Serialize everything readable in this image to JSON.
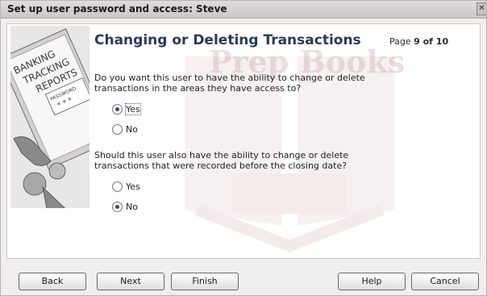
{
  "window": {
    "title": "Set up user password and access: Steve",
    "close_glyph": "✕"
  },
  "watermark": {
    "text": "Prep Books"
  },
  "art": {
    "icon": "clipboard-banking-tracking-reports-icon",
    "labels": [
      "BANKING",
      "TRACKING",
      "REPORTS",
      "PASSWORD",
      "* * *"
    ]
  },
  "header": {
    "title": "Changing or Deleting Transactions",
    "page_prefix": "Page",
    "page_value": "9 of 10"
  },
  "question1": {
    "text": "Do you want this user to have the ability to change or delete transactions in the areas they have access to?",
    "options": [
      {
        "label": "Yes",
        "selected": true
      },
      {
        "label": "No",
        "selected": false
      }
    ]
  },
  "question2": {
    "text": "Should this user also have the ability to change or delete transactions that were recorded before the closing date?",
    "options": [
      {
        "label": "Yes",
        "selected": false
      },
      {
        "label": "No",
        "selected": true
      }
    ]
  },
  "buttons": {
    "back": "Back",
    "next": "Next",
    "finish": "Finish",
    "help": "Help",
    "cancel": "Cancel"
  },
  "colors": {
    "heading": "#2c3a56",
    "watermark": "#c9a6a6"
  }
}
